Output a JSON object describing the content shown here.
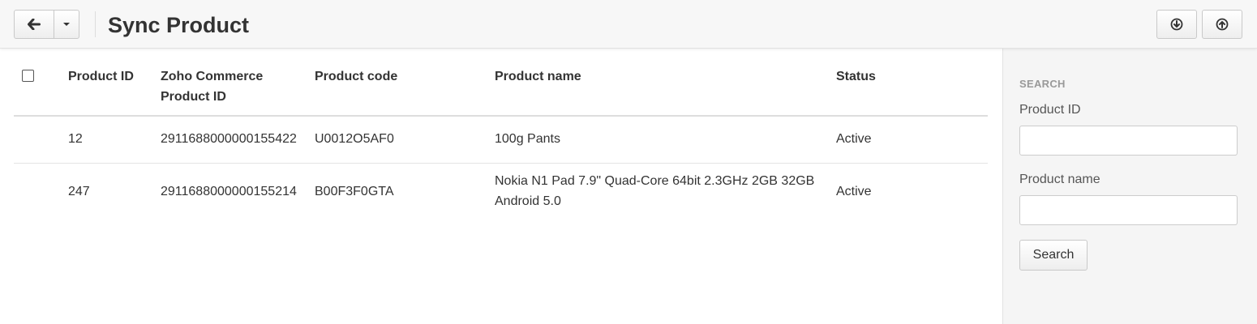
{
  "header": {
    "title": "Sync Product",
    "back_icon": "arrow-left-icon",
    "menu_icon": "caret-down-icon",
    "download_icon": "circle-arrow-down-icon",
    "upload_icon": "circle-arrow-up-icon"
  },
  "table": {
    "columns": {
      "product_id": "Product ID",
      "zoho_id_line1": "Zoho Commerce",
      "zoho_id_line2": "Product ID",
      "product_code": "Product code",
      "product_name": "Product name",
      "status": "Status"
    },
    "rows": [
      {
        "product_id": "12",
        "zoho_id": "2911688000000155422",
        "product_code": "U0012O5AF0",
        "product_name_line1": "100g Pants",
        "product_name_line2": "",
        "status": "Active"
      },
      {
        "product_id": "247",
        "zoho_id": "2911688000000155214",
        "product_code": "B00F3F0GTA",
        "product_name_line1": "Nokia N1 Pad 7.9\" Quad-Core 64bit 2.3GHz 2GB 32GB",
        "product_name_line2": "Android 5.0",
        "status": "Active"
      }
    ]
  },
  "sidebar": {
    "heading": "SEARCH",
    "product_id_label": "Product ID",
    "product_id_value": "",
    "product_name_label": "Product name",
    "product_name_value": "",
    "search_button": "Search"
  }
}
